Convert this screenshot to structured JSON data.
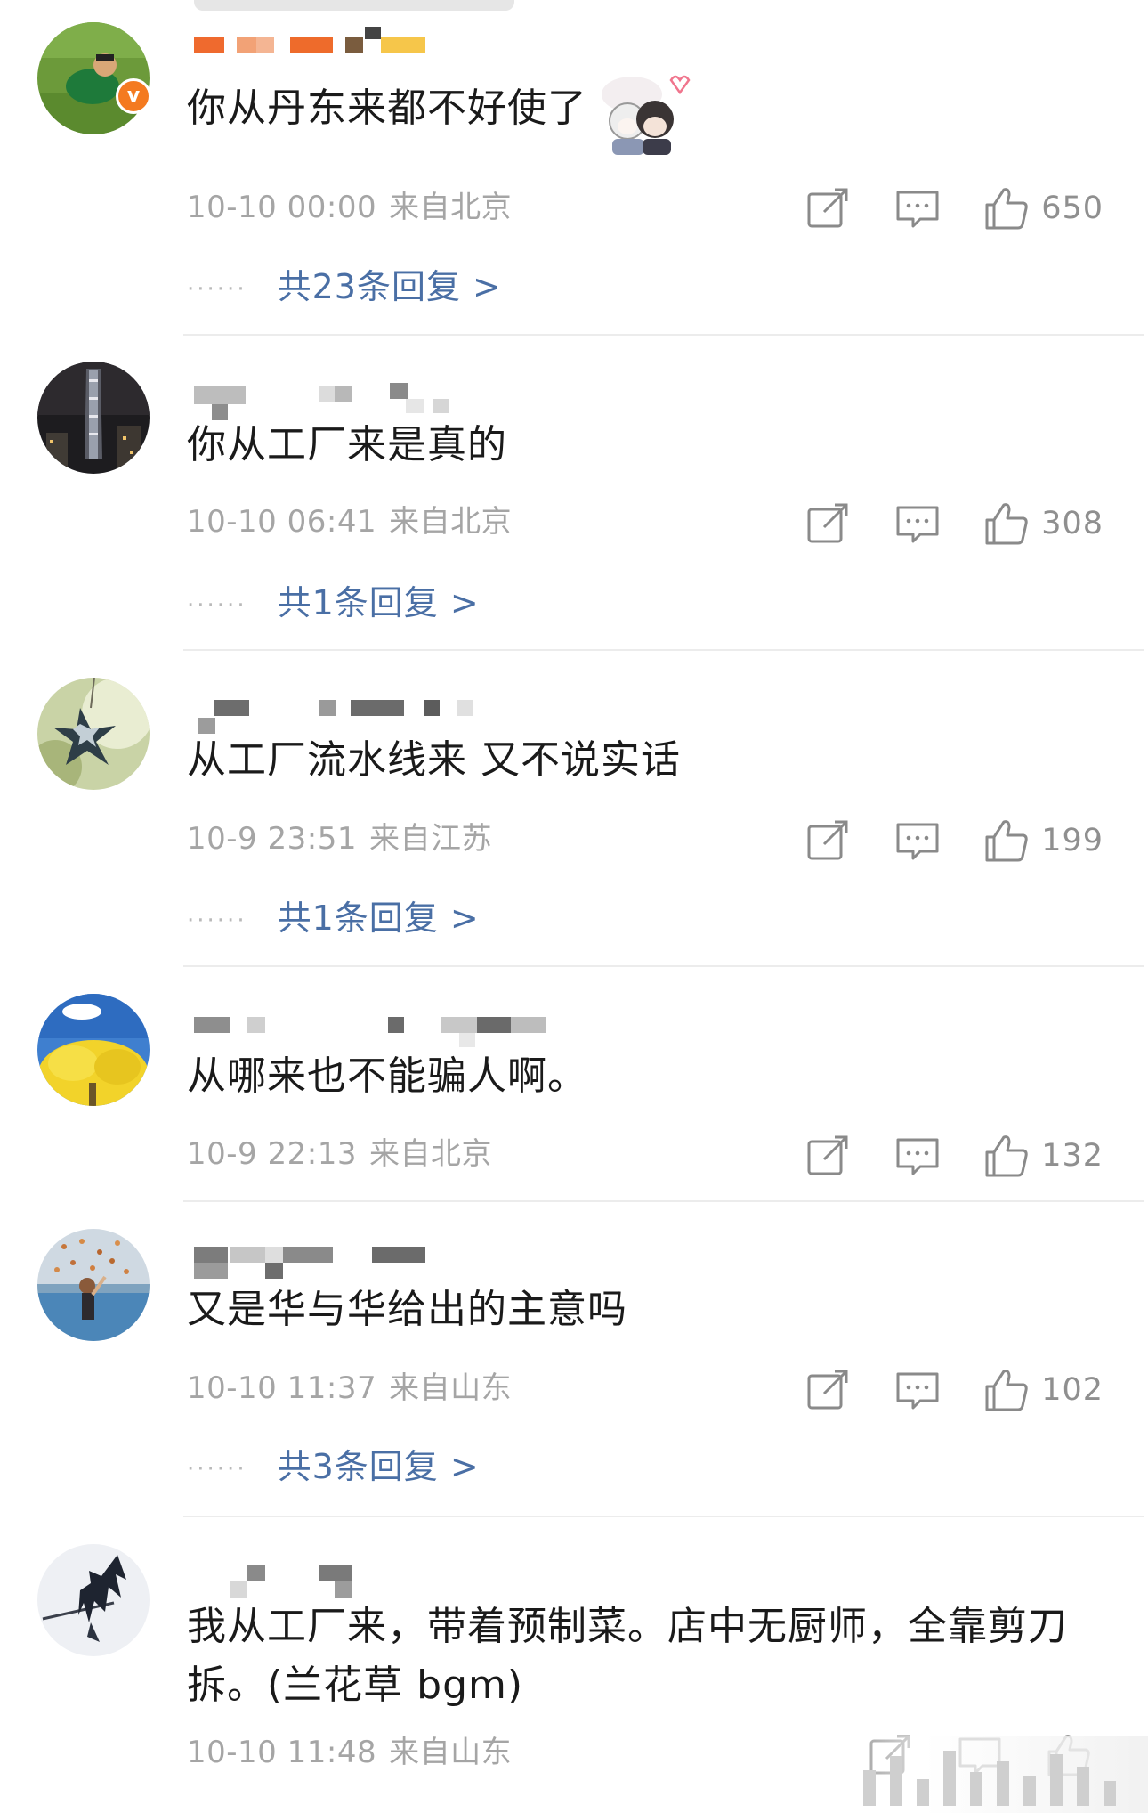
{
  "comments": [
    {
      "username": "",
      "verified": true,
      "content": "你从丹东来都不好使了",
      "time": "10-10 00:00",
      "location": "来自北京",
      "likes": "650",
      "replies_label": "共23条回复 >",
      "avatar": "man-on-grass-avatar",
      "has_sticker": true
    },
    {
      "username": "",
      "verified": false,
      "content": "你从工厂来是真的",
      "time": "10-10 06:41",
      "location": "来自北京",
      "likes": "308",
      "replies_label": "共1条回复 >",
      "avatar": "night-skyscraper-avatar"
    },
    {
      "username": "",
      "verified": false,
      "content": "从工厂流水线来 又不说实话",
      "time": "10-9 23:51",
      "location": "来自江苏",
      "likes": "199",
      "replies_label": "共1条回复 >",
      "avatar": "star-ornament-avatar"
    },
    {
      "username": "",
      "verified": false,
      "content": "从哪来也不能骗人啊。",
      "time": "10-9 22:13",
      "location": "来自北京",
      "likes": "132",
      "replies_label": "",
      "avatar": "yellow-tree-avatar"
    },
    {
      "username": "",
      "verified": false,
      "content": "又是华与华给出的主意吗",
      "time": "10-10 11:37",
      "location": "来自山东",
      "likes": "102",
      "replies_label": "共3条回复 >",
      "avatar": "autumn-leaves-avatar"
    },
    {
      "username": "",
      "verified": false,
      "content": "我从工厂来，带着预制菜。店中无厨师，全靠剪刀拆。(兰花草 bgm)",
      "content_line1": "我从工厂来，带着预制菜。店中无厨师，全靠剪刀",
      "content_line2": "拆。(兰花草 bgm)",
      "time": "10-10 11:48",
      "location": "来自山东",
      "likes": "",
      "replies_label": "",
      "avatar": "anime-swordsman-avatar"
    }
  ],
  "reply_dots": "······",
  "verified_badge_text": "v",
  "icons": {
    "share": "share-icon",
    "comment": "comment-icon",
    "like": "like-icon"
  },
  "colors": {
    "reply_link": "#4a6fa5",
    "meta_text": "#a5a5a5",
    "verified_badge": "#f47a20"
  }
}
